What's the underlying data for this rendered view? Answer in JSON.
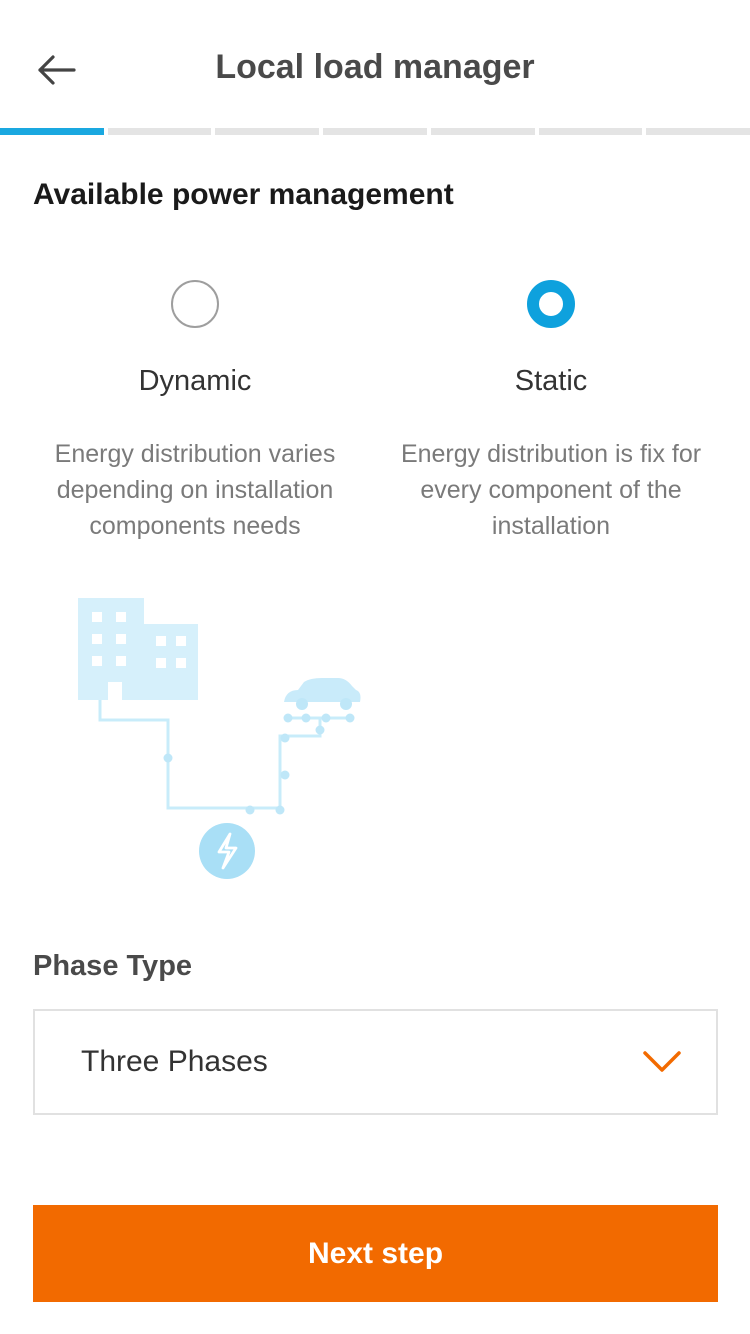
{
  "header": {
    "title": "Local load manager",
    "back_icon": "arrow-left-icon"
  },
  "progress": {
    "total_steps": 7,
    "current_step": 1,
    "active_color": "#1aa8e0"
  },
  "power_management": {
    "title": "Available power management",
    "options": [
      {
        "label": "Dynamic",
        "description": "Energy distribution varies depending on installation components needs",
        "selected": false
      },
      {
        "label": "Static",
        "description": "Energy distribution is fix for every component of the installation",
        "selected": true
      }
    ]
  },
  "illustration": {
    "icons": [
      "building-icon",
      "car-icon",
      "lightning-icon"
    ]
  },
  "phase": {
    "label": "Phase Type",
    "selected_value": "Three Phases",
    "chevron_icon": "chevron-down-icon"
  },
  "actions": {
    "next_label": "Next step",
    "accent_color": "#f26a00"
  }
}
